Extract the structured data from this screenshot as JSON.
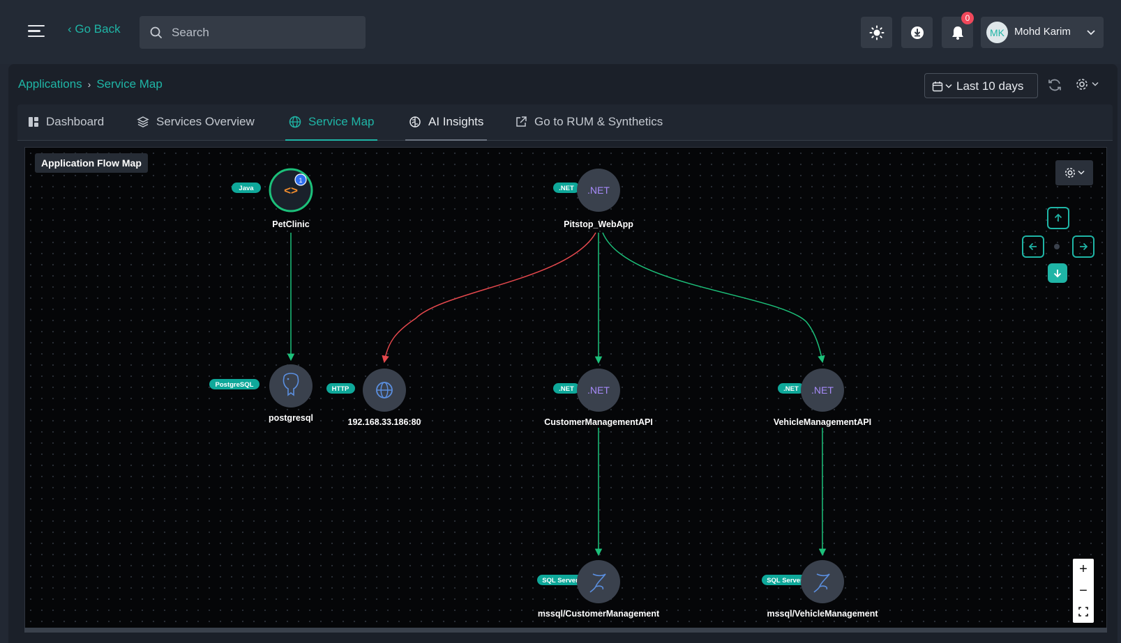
{
  "header": {
    "go_back": "Go Back",
    "search_placeholder": "Search",
    "notification_count": "0",
    "user": {
      "initials": "MK",
      "name": "Mohd Karim"
    }
  },
  "breadcrumb": {
    "parent": "Applications",
    "current": "Service Map"
  },
  "date_range": "Last 10 days",
  "tabs": [
    {
      "label": "Dashboard"
    },
    {
      "label": "Services Overview"
    },
    {
      "label": "Service Map"
    },
    {
      "label": "AI Insights"
    },
    {
      "label": "Go to RUM & Synthetics"
    }
  ],
  "map": {
    "title": "Application Flow Map",
    "nodes": [
      {
        "id": "petclinic",
        "name": "PetClinic",
        "tag": "Java",
        "icon": "code-icon",
        "alert_count": "1"
      },
      {
        "id": "pitstop",
        "name": "Pitstop_WebApp",
        "tag": ".NET",
        "icon_text": ".NET"
      },
      {
        "id": "postgresql",
        "name": "postgresql",
        "tag": "PostgreSQL",
        "icon": "postgres-elephant-icon"
      },
      {
        "id": "http",
        "name": "192.168.33.186:80",
        "tag": "HTTP",
        "icon": "globe-icon"
      },
      {
        "id": "customer",
        "name": "CustomerManagementAPI",
        "tag": ".NET",
        "icon_text": ".NET"
      },
      {
        "id": "vehicle",
        "name": "VehicleManagementAPI",
        "tag": ".NET",
        "icon_text": ".NET"
      },
      {
        "id": "mssql_customer",
        "name": "mssql/CustomerManagement",
        "tag": "SQL Server",
        "icon": "sql-server-icon"
      },
      {
        "id": "mssql_vehicle",
        "name": "mssql/VehicleManagement",
        "tag": "SQL Server",
        "icon": "sql-server-icon"
      }
    ],
    "colors": {
      "ok": "#1cc07a",
      "error": "#e5484d",
      "accent": "#1fb5a6",
      "node": "#3a414d"
    }
  }
}
